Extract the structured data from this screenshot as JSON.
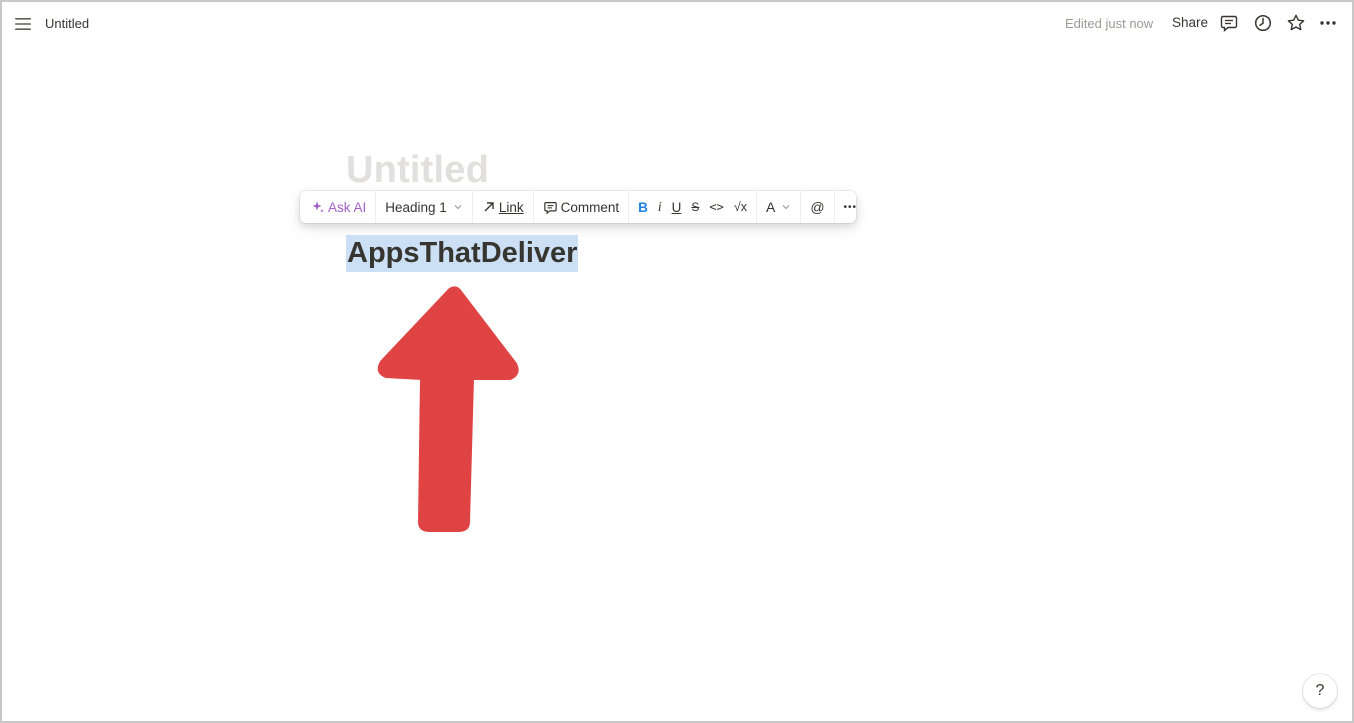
{
  "topbar": {
    "page_name": "Untitled",
    "edited": "Edited just now",
    "share_label": "Share"
  },
  "page": {
    "title_placeholder": "Untitled",
    "heading_text": "AppsThatDeliver"
  },
  "toolbar": {
    "ask_ai": "Ask AI",
    "block_type": "Heading 1",
    "link": "Link",
    "comment": "Comment",
    "bold": "B",
    "italic": "i",
    "underline": "U",
    "strike": "S",
    "code": "<>",
    "math": "√x",
    "color": "A",
    "mention": "@",
    "more": "•••"
  },
  "help": {
    "label": "?"
  },
  "colors": {
    "selection": "#cce0f5",
    "ai_purple": "#a361c7",
    "bold_blue": "#2383e2",
    "arrow_red": "#e04343"
  },
  "icons": [
    "menu-icon",
    "comment-icon",
    "history-icon",
    "star-icon",
    "more-icon",
    "sparkle-icon",
    "arrow-up-right-icon",
    "comment-bubble-icon",
    "chevron-down-icon",
    "red-arrow-up"
  ]
}
